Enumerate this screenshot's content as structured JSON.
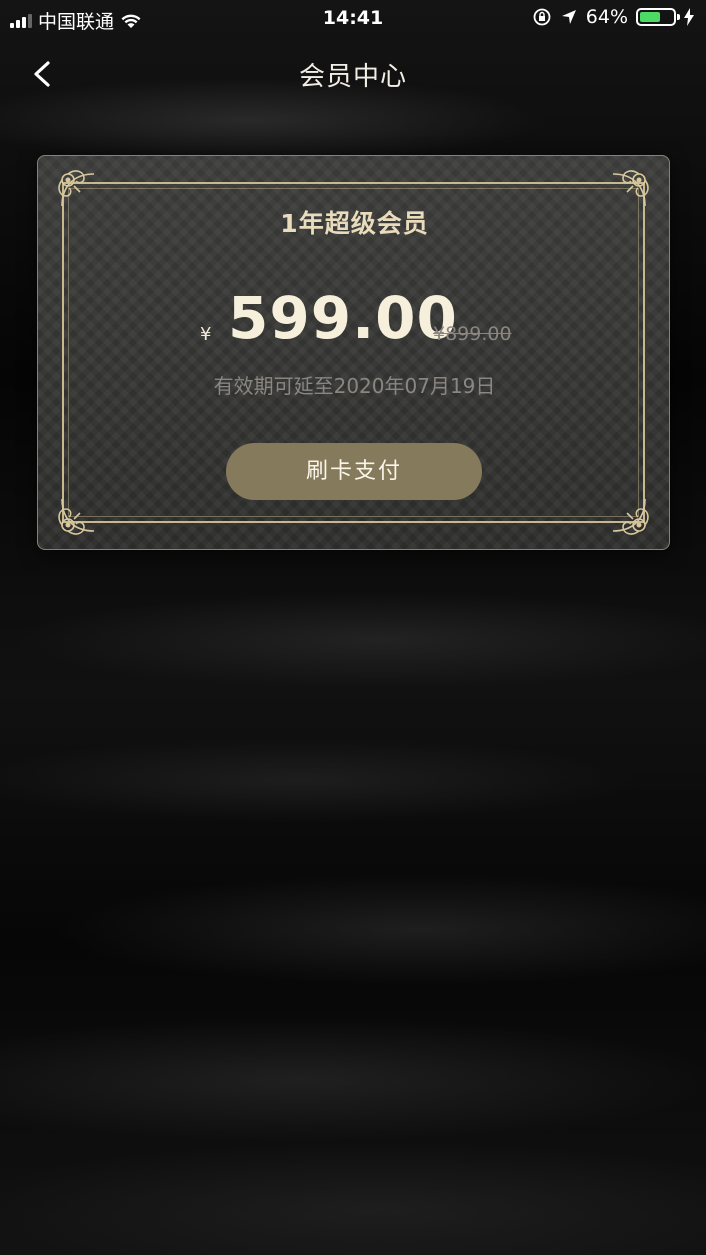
{
  "status_bar": {
    "carrier": "中国联通",
    "time": "14:41",
    "battery_percent": "64%",
    "battery_level": 0.64,
    "icons": [
      "signal-icon",
      "wifi-icon",
      "orientation-lock-icon",
      "location-icon",
      "battery-icon",
      "charging-icon"
    ]
  },
  "nav": {
    "title": "会员中心",
    "back_icon": "chevron-left-icon"
  },
  "card": {
    "plan_title": "1年超级会员",
    "currency_symbol": "¥",
    "price": "599.00",
    "original_price": "¥899.00",
    "validity_text": "有效期可延至2020年07月19日",
    "pay_button_label": "刷卡支付"
  },
  "colors": {
    "background": "#050505",
    "card_background": "#363635",
    "gold": "#c8b88e",
    "title_gold": "#e9dcbc",
    "button": "#857a5c",
    "muted_text": "#8a8781",
    "battery_green": "#4cd964"
  }
}
